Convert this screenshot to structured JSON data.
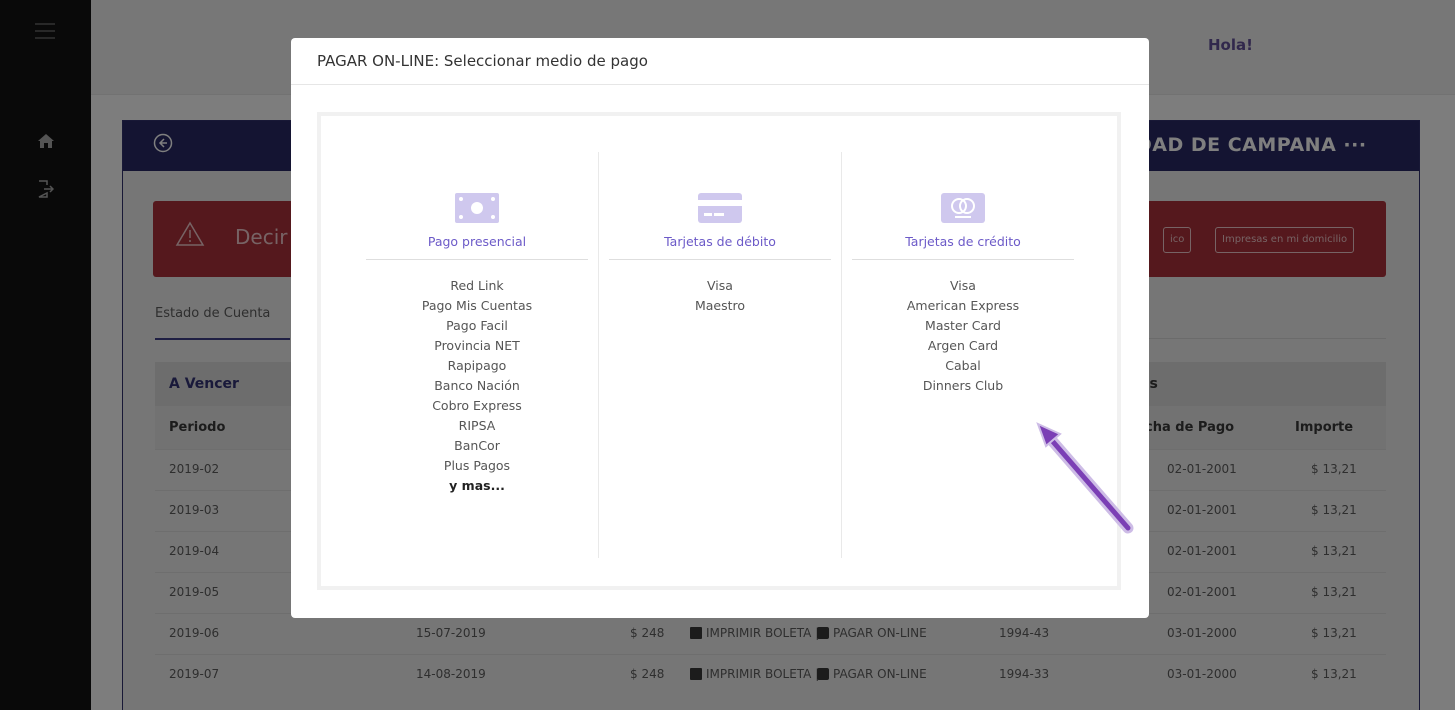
{
  "header": {
    "greeting": "Hola!"
  },
  "card": {
    "entity_title": "DAD DE CAMPANA ···"
  },
  "alert": {
    "text": "Decir",
    "btn_1": "ico",
    "btn_2": "Impresas en mi domicilio"
  },
  "tabs": {
    "estado": "Estado de Cuenta"
  },
  "table": {
    "section_title": "A Vencer",
    "right_section_title": "es",
    "columns": {
      "periodo": "Periodo",
      "fecha_pago": "cha de Pago",
      "importe": "Importe"
    },
    "rows": [
      {
        "periodo": "2019-02",
        "vencimiento": "",
        "monto": "",
        "print": "",
        "pay": "",
        "ref": "",
        "fecha_pago": "02-01-2001",
        "importe": "$ 13,21"
      },
      {
        "periodo": "2019-03",
        "vencimiento": "",
        "monto": "",
        "print": "",
        "pay": "",
        "ref": "",
        "fecha_pago": "02-01-2001",
        "importe": "$ 13,21"
      },
      {
        "periodo": "2019-04",
        "vencimiento": "",
        "monto": "",
        "print": "",
        "pay": "",
        "ref": "",
        "fecha_pago": "02-01-2001",
        "importe": "$ 13,21"
      },
      {
        "periodo": "2019-05",
        "vencimiento": "",
        "monto": "",
        "print": "",
        "pay": "",
        "ref": "",
        "fecha_pago": "02-01-2001",
        "importe": "$ 13,21"
      },
      {
        "periodo": "2019-06",
        "vencimiento": "15-07-2019",
        "monto": "$ 248",
        "print": "IMPRIMIR BOLETA |",
        "pay": "PAGAR ON-LINE",
        "ref": "1994-43",
        "fecha_pago": "03-01-2000",
        "importe": "$ 13,21"
      },
      {
        "periodo": "2019-07",
        "vencimiento": "14-08-2019",
        "monto": "$ 248",
        "print": "IMPRIMIR BOLETA |",
        "pay": "PAGAR ON-LINE",
        "ref": "1994-33",
        "fecha_pago": "03-01-2000",
        "importe": "$ 13,21"
      }
    ]
  },
  "modal": {
    "title": "PAGAR ON-LINE: Seleccionar medio de pago",
    "columns": [
      {
        "title": "Pago presencial",
        "icon": "cash-icon",
        "items": [
          "Red Link",
          "Pago Mis Cuentas",
          "Pago Facil",
          "Provincia NET",
          "Rapipago",
          "Banco Nación",
          "Cobro Express",
          "RIPSA",
          "BanCor",
          "Plus Pagos"
        ],
        "more": "y mas..."
      },
      {
        "title": "Tarjetas de débito",
        "icon": "credit-card-icon",
        "items": [
          "Visa",
          "Maestro"
        ]
      },
      {
        "title": "Tarjetas de crédito",
        "icon": "mastercard-icon",
        "items": [
          "Visa",
          "American Express",
          "Master Card",
          "Argen Card",
          "Cabal",
          "Dinners Club"
        ]
      }
    ]
  },
  "colors": {
    "accent": "#6c5ac8",
    "arrow": "#7b3fb5",
    "header": "#25265c",
    "alert": "#9b2d35"
  }
}
